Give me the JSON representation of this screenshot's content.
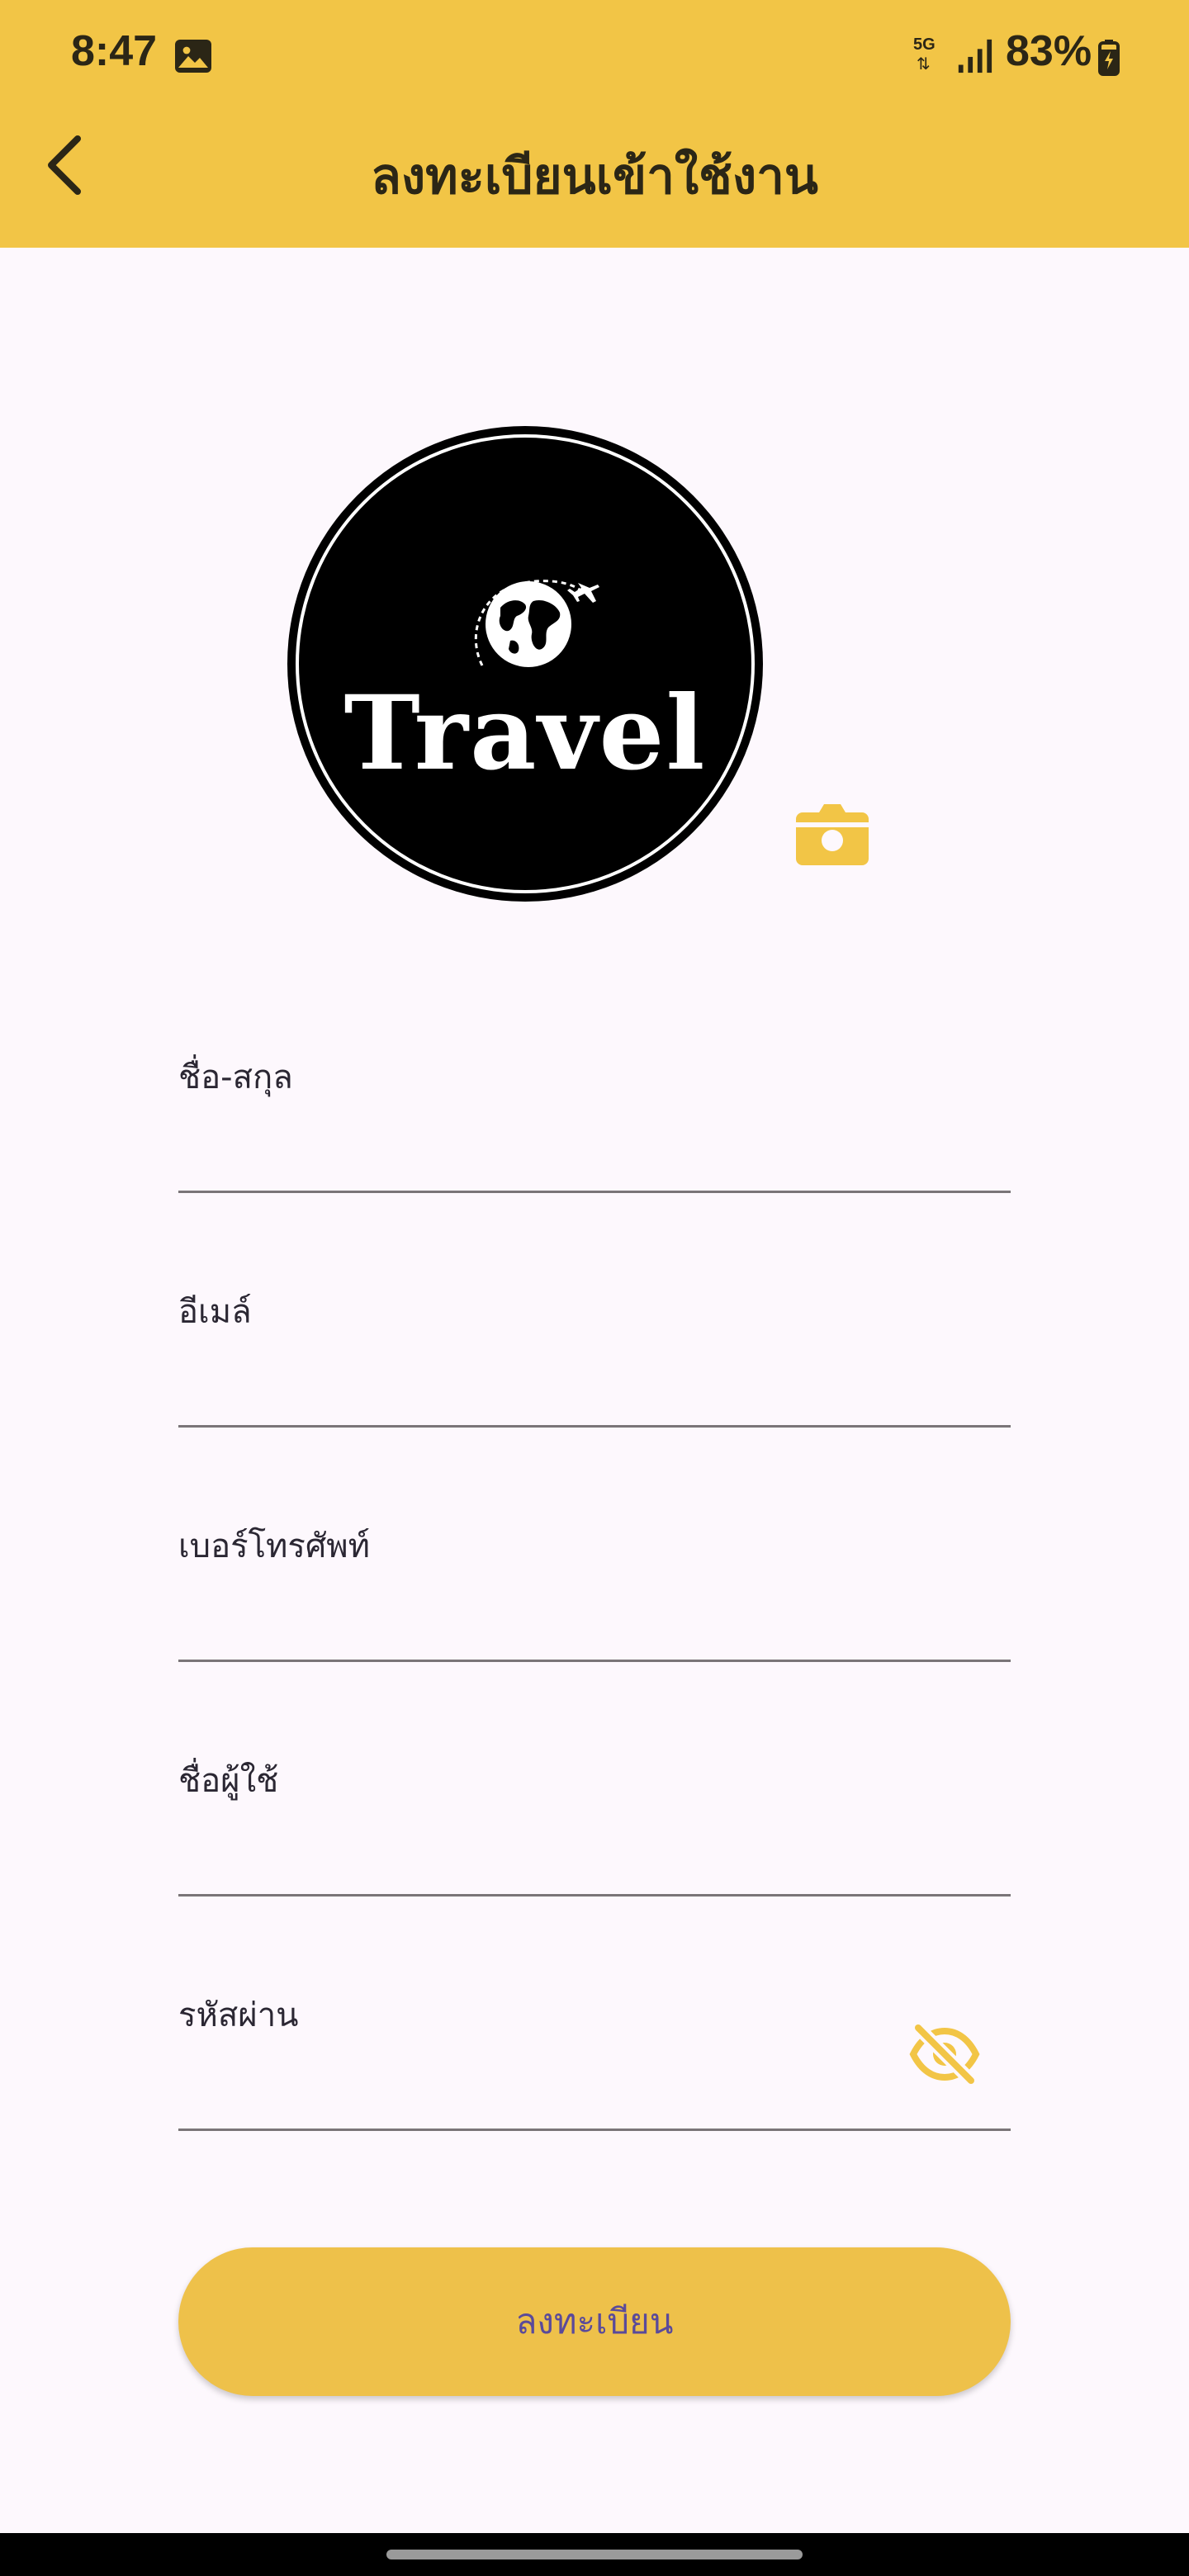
{
  "status_bar": {
    "time": "8:47",
    "network": "5G",
    "battery": "83%"
  },
  "header": {
    "title": "ลงทะเบียนเข้าใช้งาน",
    "back_icon": "chevron-left-icon"
  },
  "logo": {
    "text": "Travel"
  },
  "form": {
    "fullname_label": "ชื่อ-สกุล",
    "fullname_value": "",
    "email_label": "อีเมล์",
    "email_value": "",
    "phone_label": "เบอร์โทรศัพท์",
    "phone_value": "",
    "username_label": "ชื่อผู้ใช้",
    "username_value": "",
    "password_label": "รหัสผ่าน",
    "password_value": ""
  },
  "submit": {
    "label": "ลงทะเบียน"
  },
  "colors": {
    "header": "#f2c546",
    "accent": "#eec14a",
    "button_text": "#5a4a9a",
    "background": "#fdf8fd"
  }
}
